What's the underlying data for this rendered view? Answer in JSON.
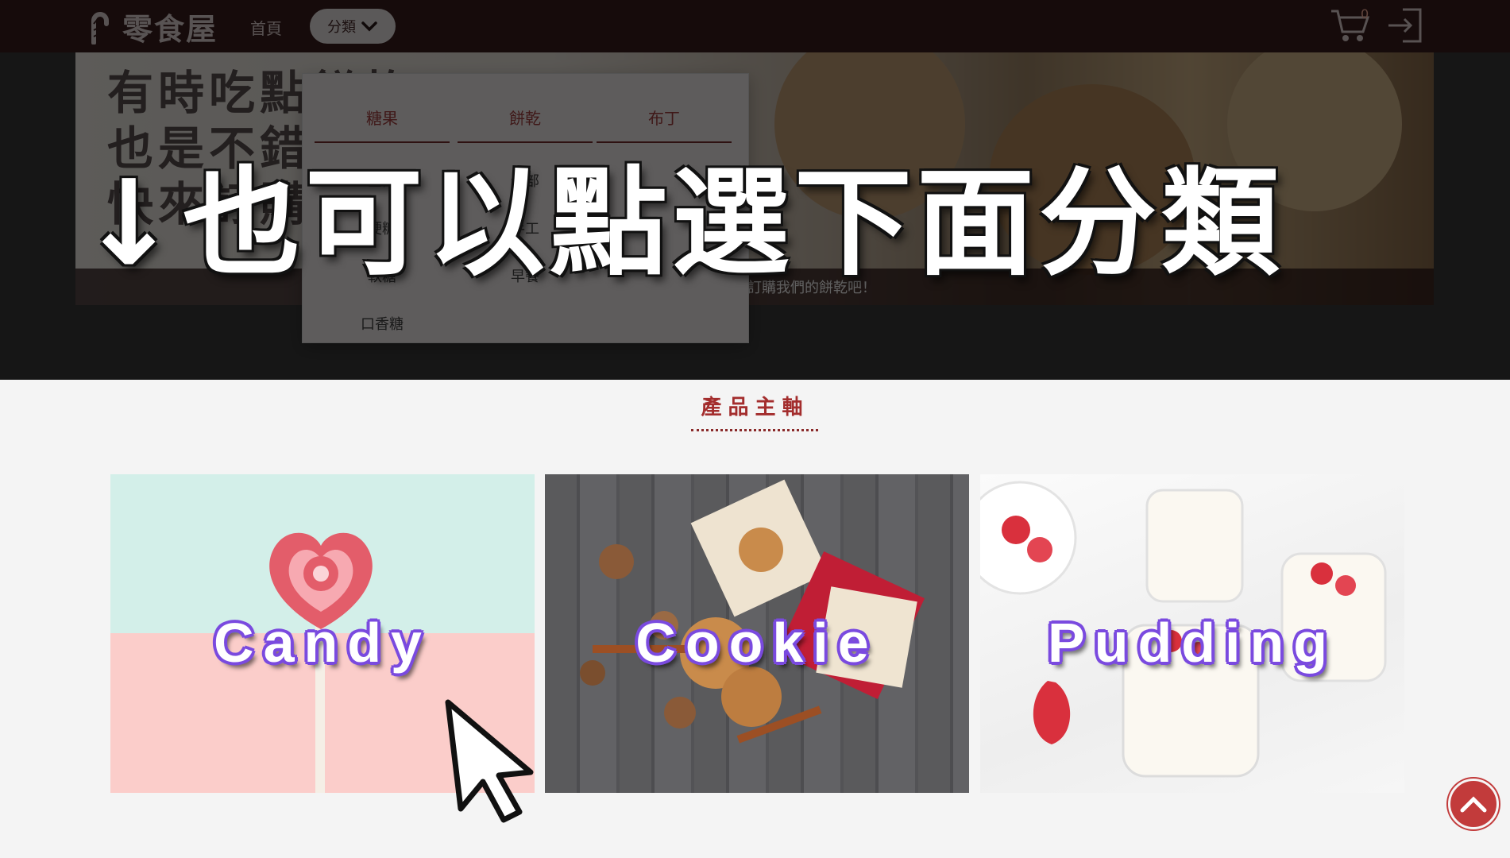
{
  "navbar": {
    "logo_text": "零食屋",
    "home_label": "首頁",
    "category_label": "分類",
    "cart_count": "0"
  },
  "hero": {
    "lines": [
      "有時吃點餅乾",
      "也是不錯",
      "快來訂購吧"
    ],
    "caption": "不錯的選擇！快來訂購我們的餅乾吧！"
  },
  "dropdown": {
    "columns": [
      {
        "header": "糖果",
        "items": [
          "全部",
          "硬糖",
          "軟糖",
          "口香糖"
        ]
      },
      {
        "header": "餅乾",
        "items": [
          "全部",
          "手工",
          "早餐"
        ]
      },
      {
        "header": "布丁",
        "items": []
      }
    ]
  },
  "overlay": {
    "message": "↓也可以點選下面分類"
  },
  "section": {
    "title": "產品主軸"
  },
  "products": [
    {
      "label": "Candy"
    },
    {
      "label": "Cookie"
    },
    {
      "label": "Pudding"
    }
  ],
  "colors": {
    "navbar": "#3a1e1e",
    "accent": "#a32d2d",
    "label_outline": "#7a4adf",
    "to_top": "#c23b3b"
  },
  "icons": [
    "cart-icon",
    "login-icon",
    "chevron-down-icon",
    "chevron-up-icon",
    "pointer-cursor-icon"
  ]
}
